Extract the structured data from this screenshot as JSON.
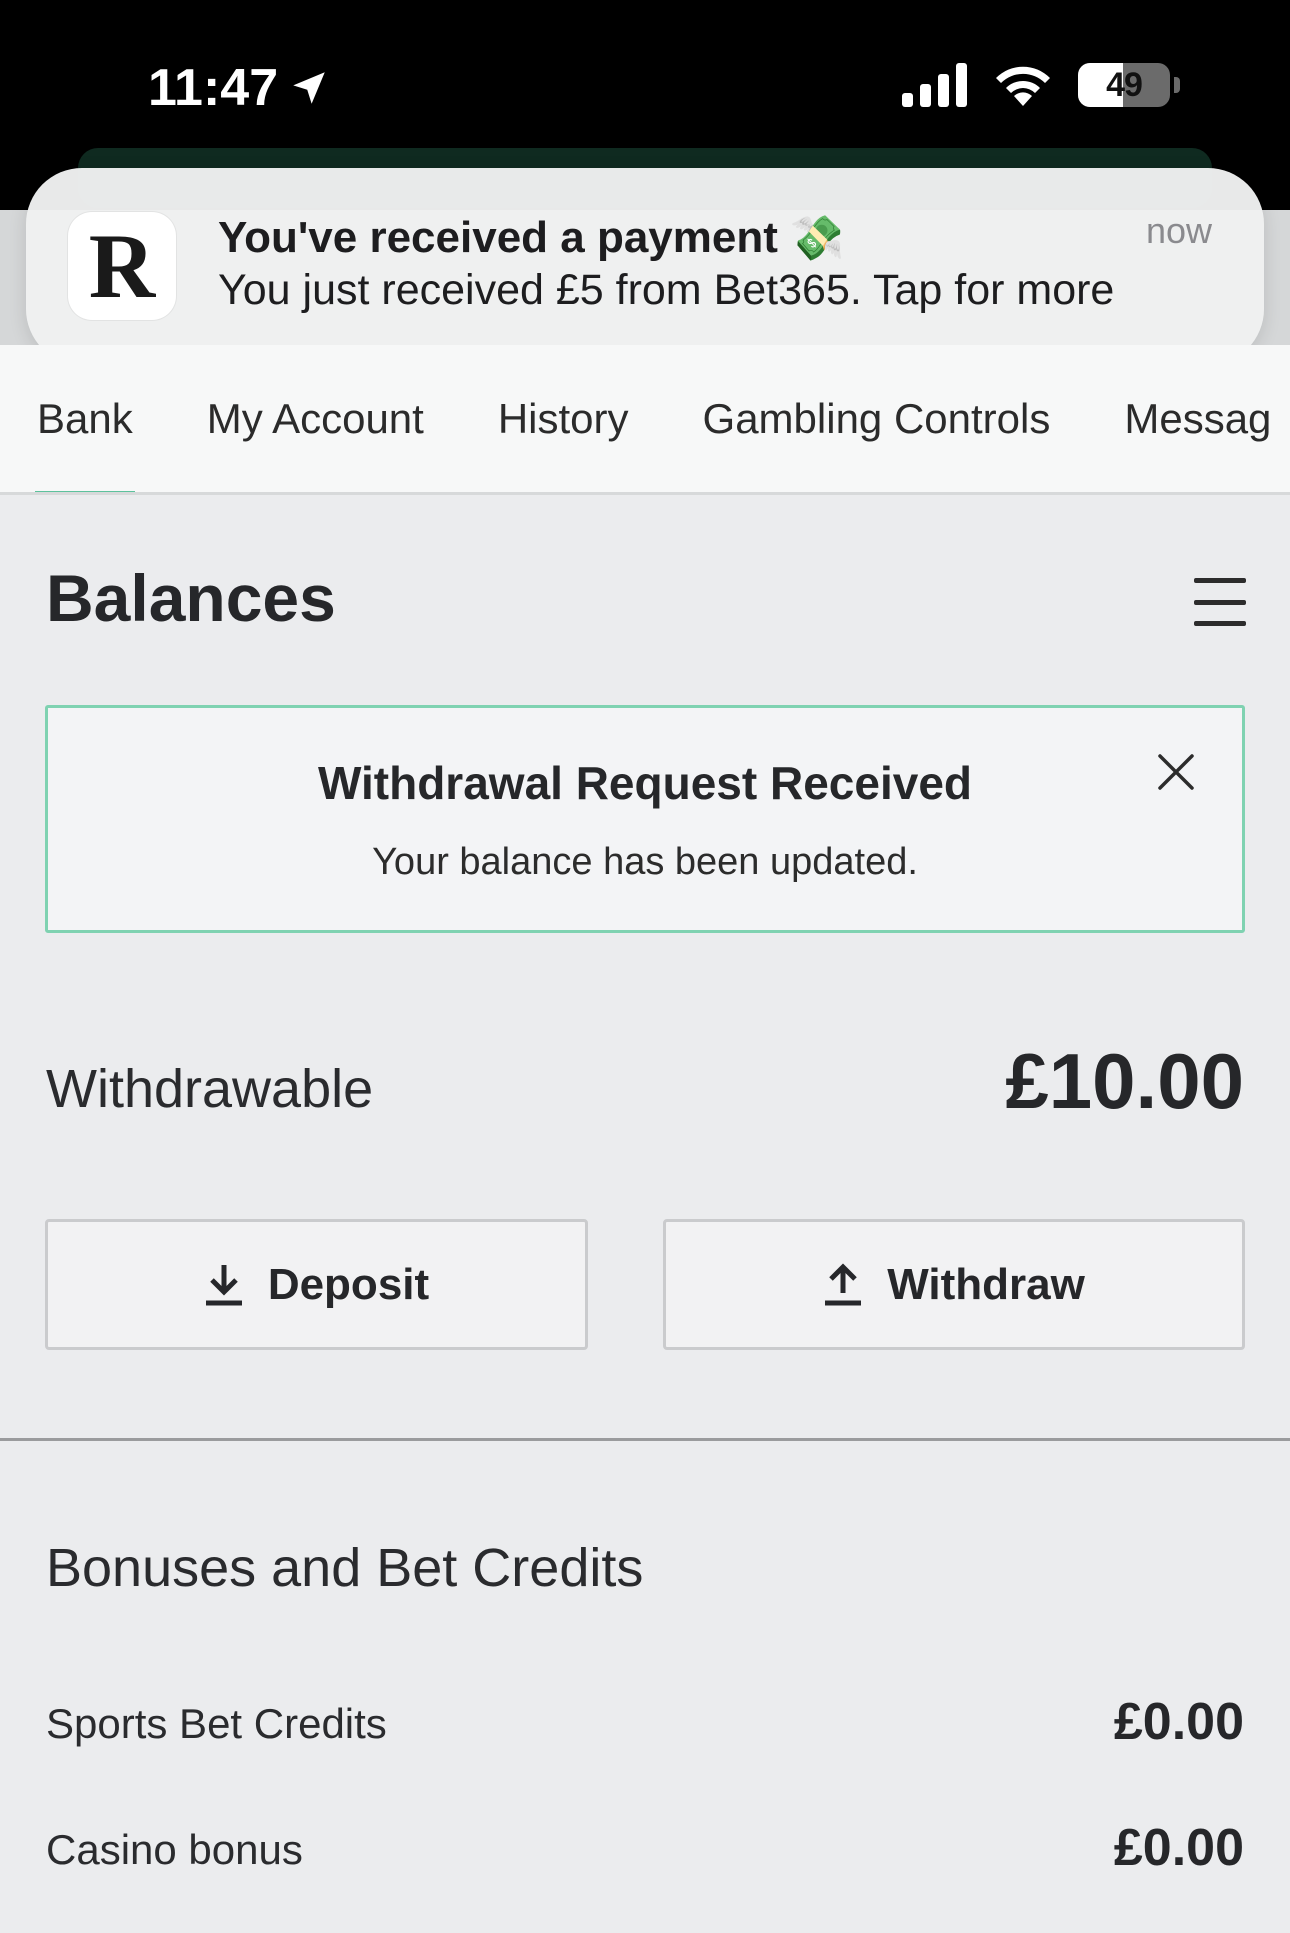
{
  "status_bar": {
    "time": "11:47",
    "battery_level": "49",
    "battery_fraction": 0.49
  },
  "notification": {
    "app_initial": "R",
    "title": "You've received a payment",
    "title_emoji": "💸",
    "body": "You just received £5 from Bet365. Tap for more",
    "time": "now"
  },
  "tabs": [
    {
      "label": "Bank",
      "active": true
    },
    {
      "label": "My Account",
      "active": false
    },
    {
      "label": "History",
      "active": false
    },
    {
      "label": "Gambling Controls",
      "active": false
    },
    {
      "label": "Messag",
      "active": false
    }
  ],
  "balances": {
    "title": "Balances",
    "alert": {
      "title": "Withdrawal Request Received",
      "text": "Your balance has been updated."
    },
    "withdrawable_label": "Withdrawable",
    "withdrawable_amount": "£10.00",
    "deposit_label": "Deposit",
    "withdraw_label": "Withdraw"
  },
  "bonuses": {
    "title": "Bonuses and Bet Credits",
    "rows": [
      {
        "label": "Sports Bet Credits",
        "value": "£0.00"
      },
      {
        "label": "Casino bonus",
        "value": "£0.00"
      }
    ]
  },
  "colors": {
    "accent": "#5dc29d",
    "alert_border": "#7fd2b1",
    "background": "#ebecee"
  },
  "icons": {
    "location": "location-arrow-icon",
    "signal": "cellular-signal-icon",
    "wifi": "wifi-icon",
    "battery": "battery-icon",
    "menu": "hamburger-menu-icon",
    "close": "close-icon",
    "deposit": "download-icon",
    "withdraw": "upload-icon"
  }
}
